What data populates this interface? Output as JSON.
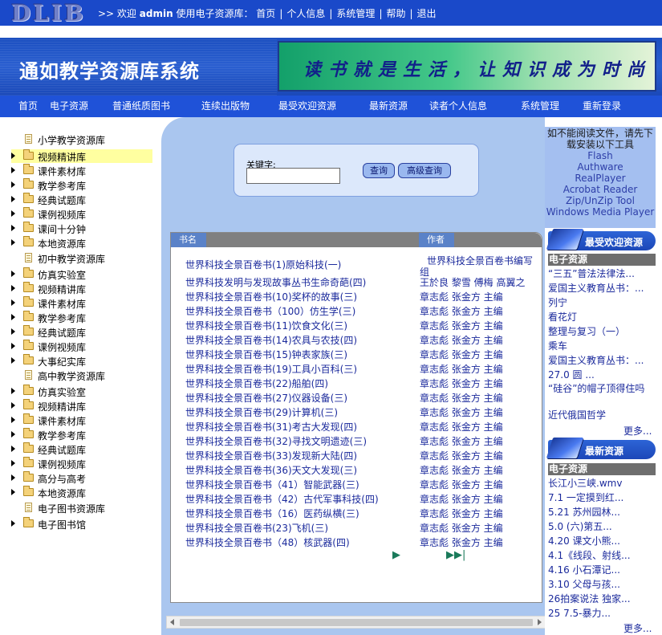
{
  "header": {
    "logo": "DLIB",
    "welcome_prefix": ">> 欢迎",
    "user": "admin",
    "welcome_suffix": "使用电子资源库：",
    "links": [
      "首页",
      "个人信息",
      "系统管理",
      "帮助",
      "退出"
    ]
  },
  "banner": {
    "title": "通如教学资源库系统",
    "slogan": "读书就是生活，让知识成为时尚"
  },
  "nav": [
    "首页",
    "电子资源",
    "普通纸质图书",
    "连续出版物",
    "最受欢迎资源",
    "最新资源",
    "读者个人信息",
    "系统管理",
    "重新登录"
  ],
  "tree": [
    {
      "label": "小学教学资源库",
      "kind": "doc",
      "arrow": false,
      "active": false
    },
    {
      "label": "视频精讲库",
      "kind": "folder",
      "arrow": true,
      "active": true
    },
    {
      "label": "课件素材库",
      "kind": "folder",
      "arrow": true,
      "active": false
    },
    {
      "label": "教学参考库",
      "kind": "folder",
      "arrow": true,
      "active": false
    },
    {
      "label": "经典试题库",
      "kind": "folder",
      "arrow": true,
      "active": false
    },
    {
      "label": "课例视频库",
      "kind": "folder",
      "arrow": true,
      "active": false
    },
    {
      "label": "课间十分钟",
      "kind": "folder",
      "arrow": true,
      "active": false
    },
    {
      "label": "本地资源库",
      "kind": "folder",
      "arrow": true,
      "active": false
    },
    {
      "label": "初中教学资源库",
      "kind": "doc",
      "arrow": false,
      "active": false
    },
    {
      "label": "仿真实验室",
      "kind": "folder",
      "arrow": true,
      "active": false
    },
    {
      "label": "视频精讲库",
      "kind": "folder",
      "arrow": true,
      "active": false
    },
    {
      "label": "课件素材库",
      "kind": "folder",
      "arrow": true,
      "active": false
    },
    {
      "label": "教学参考库",
      "kind": "folder",
      "arrow": true,
      "active": false
    },
    {
      "label": "经典试题库",
      "kind": "folder",
      "arrow": true,
      "active": false
    },
    {
      "label": "课例视频库",
      "kind": "folder",
      "arrow": true,
      "active": false
    },
    {
      "label": "大事纪实库",
      "kind": "folder",
      "arrow": true,
      "active": false
    },
    {
      "label": "高中教学资源库",
      "kind": "doc",
      "arrow": false,
      "active": false
    },
    {
      "label": "仿真实验室",
      "kind": "folder",
      "arrow": true,
      "active": false
    },
    {
      "label": "视频精讲库",
      "kind": "folder",
      "arrow": true,
      "active": false
    },
    {
      "label": "课件素材库",
      "kind": "folder",
      "arrow": true,
      "active": false
    },
    {
      "label": "教学参考库",
      "kind": "folder",
      "arrow": true,
      "active": false
    },
    {
      "label": "经典试题库",
      "kind": "folder",
      "arrow": true,
      "active": false
    },
    {
      "label": "课例视频库",
      "kind": "folder",
      "arrow": true,
      "active": false
    },
    {
      "label": "高分与高考",
      "kind": "folder",
      "arrow": true,
      "active": false
    },
    {
      "label": "本地资源库",
      "kind": "folder",
      "arrow": true,
      "active": false
    },
    {
      "label": "电子图书资源库",
      "kind": "doc",
      "arrow": false,
      "active": false
    },
    {
      "label": "电子图书馆",
      "kind": "folder",
      "arrow": true,
      "active": false
    }
  ],
  "search": {
    "label": "关键字:",
    "value": "",
    "query_button": "查询",
    "advanced_button": "高级查询"
  },
  "results": {
    "col_title": "书名",
    "col_author": "作者",
    "rows": [
      {
        "title": "世界科技全景百卷书(1)原始科技(一)",
        "author": "世界科技全景百卷书编写组"
      },
      {
        "title": "世界科技发明与发现故事丛书生命奇葩(四)",
        "author": "王於良 黎雪 傅梅 高翼之"
      },
      {
        "title": "世界科技全景百卷书(10)奖杯的故事(三)",
        "author": "章志彪 张金方 主编"
      },
      {
        "title": "世界科技全景百卷书（100）仿生学(三)",
        "author": "章志彪 张金方 主编"
      },
      {
        "title": "世界科技全景百卷书(11)饮食文化(三)",
        "author": "章志彪 张金方 主编"
      },
      {
        "title": "世界科技全景百卷书(14)农具与农技(四)",
        "author": "章志彪 张金方 主编"
      },
      {
        "title": "世界科技全景百卷书(15)钟表家族(三)",
        "author": "章志彪 张金方 主编"
      },
      {
        "title": "世界科技全景百卷书(19)工具小百科(三)",
        "author": "章志彪 张金方 主编"
      },
      {
        "title": "世界科技全景百卷书(22)船舶(四)",
        "author": "章志彪 张金方 主编"
      },
      {
        "title": "世界科技全景百卷书(27)仪器设备(三)",
        "author": "章志彪 张金方 主编"
      },
      {
        "title": "世界科技全景百卷书(29)计算机(三)",
        "author": "章志彪 张金方 主编"
      },
      {
        "title": "世界科技全景百卷书(31)考古大发现(四)",
        "author": "章志彪 张金方 主编"
      },
      {
        "title": "世界科技全景百卷书(32)寻找文明遗迹(三)",
        "author": "章志彪 张金方 主编"
      },
      {
        "title": "世界科技全景百卷书(33)发现新大陆(四)",
        "author": "章志彪 张金方 主编"
      },
      {
        "title": "世界科技全景百卷书(36)天文大发现(三)",
        "author": "章志彪 张金方 主编"
      },
      {
        "title": "世界科技全景百卷书（41）智能武器(三)",
        "author": "章志彪 张金方 主编"
      },
      {
        "title": "世界科技全景百卷书（42）古代军事科技(四)",
        "author": "章志彪 张金方 主编"
      },
      {
        "title": "世界科技全景百卷书（16）医药纵横(三)",
        "author": "章志彪 张金方 主编"
      },
      {
        "title": "世界科技全景百卷书(23)飞机(三)",
        "author": "章志彪 张金方 主编"
      },
      {
        "title": "世界科技全景百卷书（48）核武器(四)",
        "author": "章志彪 张金方 主编"
      }
    ]
  },
  "notice": {
    "text": "如不能阅读文件，请先下载安装以下工具",
    "tools": [
      "Flash",
      "Authware",
      "RealPlayer",
      "Acrobat Reader",
      "Zip/UnZip Tool",
      "Windows Media Player"
    ]
  },
  "popular": {
    "heading": "最受欢迎资源",
    "category": "电子资源",
    "items": [
      "“三五”普法法律法...",
      "爱国主义教育丛书：...",
      "列宁",
      "看花灯",
      "整理与复习（一）",
      "乘车",
      "爱国主义教育丛书：...",
      "27.0 圆 ...",
      "“硅谷”的帽子顶得住吗",
      "近代俄国哲学"
    ],
    "more": "更多..."
  },
  "newest": {
    "heading": "最新资源",
    "category": "电子资源",
    "items": [
      "长江小三峡.wmv",
      "7.1 一定摸到红...",
      "5.21 苏州园林...",
      "5.0 (六)第五...",
      "4.20 课文小熊...",
      "4.1《线段、射线...",
      "4.16 小石潭记...",
      "3.10 父母与孩...",
      "26拍案说法 独家...",
      "25 7.5-暴力..."
    ],
    "more": "更多..."
  },
  "colors": {
    "topbar": "#1a49c9",
    "nav": "#1f52d8",
    "main_bg": "#aac6ef",
    "link": "#1b2a9c"
  }
}
